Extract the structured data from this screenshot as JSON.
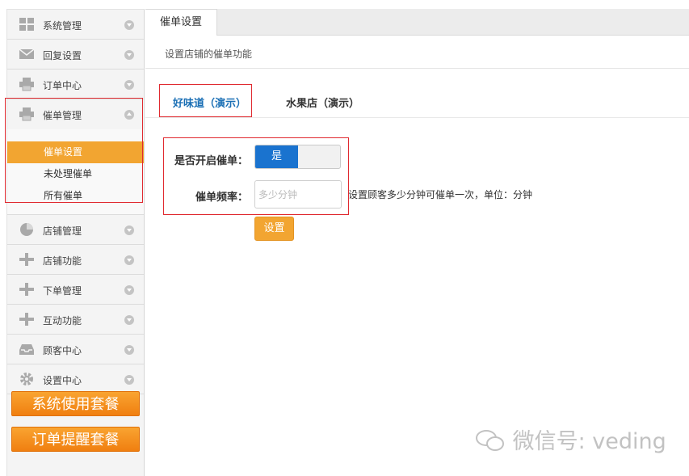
{
  "sidebar": {
    "items": [
      {
        "label": "系统管理",
        "icon": "grid-icon"
      },
      {
        "label": "回复设置",
        "icon": "mail-icon"
      },
      {
        "label": "订单中心",
        "icon": "printer-icon"
      },
      {
        "label": "催单管理",
        "icon": "printer-icon"
      },
      {
        "label": "店铺管理",
        "icon": "pie-chart-icon"
      },
      {
        "label": "店铺功能",
        "icon": "plus-icon"
      },
      {
        "label": "下单管理",
        "icon": "plus-icon"
      },
      {
        "label": "互动功能",
        "icon": "plus-icon"
      },
      {
        "label": "顾客中心",
        "icon": "inbox-icon"
      },
      {
        "label": "设置中心",
        "icon": "gear-icon"
      }
    ],
    "subitems": [
      "催单设置",
      "未处理催单",
      "所有催单"
    ],
    "active_subitem": "催单设置",
    "buttons": [
      "系统使用套餐",
      "订单提醒套餐"
    ]
  },
  "tab": {
    "label": "催单设置"
  },
  "description": "设置店铺的催单功能",
  "shops": [
    "好味道（演示）",
    "水果店（演示）"
  ],
  "form": {
    "enable_label": "是否开启催单：",
    "toggle_on": "是",
    "freq_label": "催单频率：",
    "freq_placeholder": "多少分钟",
    "freq_hint": "设置顾客多少分钟可催单一次，单位：分钟",
    "submit": "设置"
  },
  "watermark": "微信号: veding",
  "colors": {
    "accent_orange": "#f2a531",
    "toggle_blue": "#1a73cf",
    "shop_active": "#1a6fb5",
    "highlight_red": "#e0292f"
  }
}
